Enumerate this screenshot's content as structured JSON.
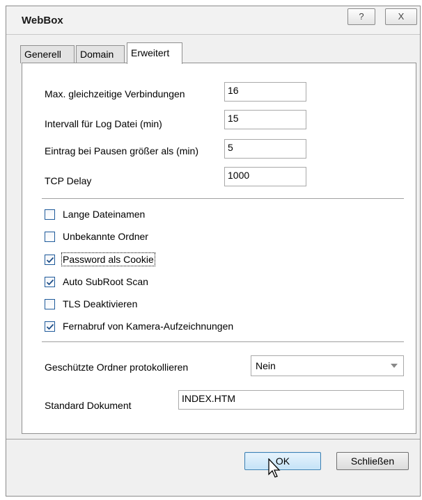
{
  "window": {
    "title": "WebBox",
    "help_label": "?",
    "close_label": "X"
  },
  "tabs": [
    {
      "label": "Generell",
      "active": false
    },
    {
      "label": "Domain",
      "active": false
    },
    {
      "label": "Erweitert",
      "active": true
    }
  ],
  "fields": [
    {
      "label": "Max. gleichzeitige Verbindungen",
      "value": "16"
    },
    {
      "label": "Intervall für Log Datei (min)",
      "value": "15"
    },
    {
      "label": "Eintrag bei Pausen größer als (min)",
      "value": "5"
    },
    {
      "label": "TCP Delay",
      "value": "1000"
    }
  ],
  "checkboxes": [
    {
      "label": "Lange Dateinamen",
      "checked": false
    },
    {
      "label": "Unbekannte Ordner",
      "checked": false
    },
    {
      "label": "Password als Cookie",
      "checked": true
    },
    {
      "label": "Auto SubRoot Scan",
      "checked": true
    },
    {
      "label": "TLS Deaktivieren",
      "checked": false
    },
    {
      "label": "Fernabruf von Kamera-Aufzeichnungen",
      "checked": true
    }
  ],
  "protect": {
    "label": "Geschützte Ordner protokollieren",
    "selected": "Nein"
  },
  "standard_doc": {
    "label": "Standard Dokument",
    "value": "INDEX.HTM"
  },
  "buttons": {
    "ok": "OK",
    "close": "Schließen"
  },
  "colors": {
    "focus_accent": "#3c7fb1",
    "checkbox_border": "#1e5a9a",
    "checkmark": "#1f4f88"
  }
}
